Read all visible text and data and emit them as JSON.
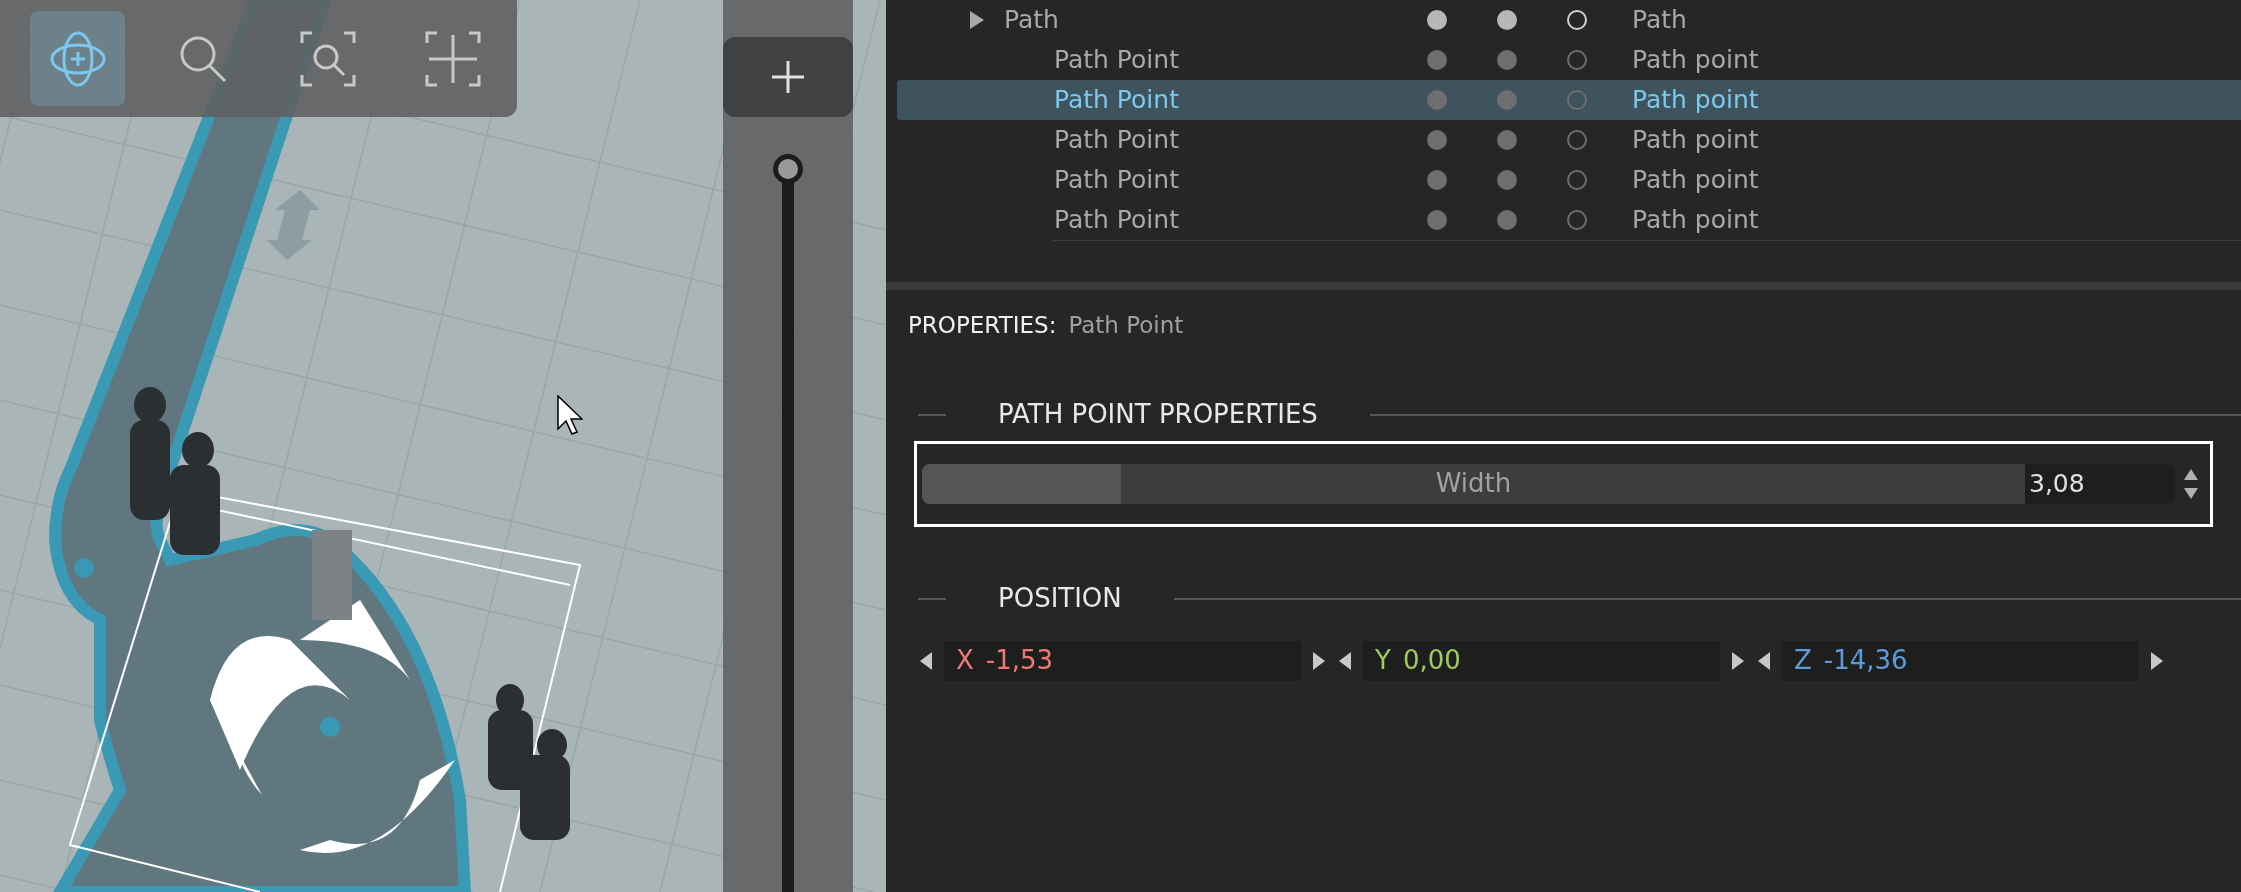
{
  "viewport": {
    "toolbar": [
      {
        "kind": "orbit",
        "selected": true
      },
      {
        "kind": "zoom",
        "selected": false
      },
      {
        "kind": "zoom_fit",
        "selected": false
      },
      {
        "kind": "frame",
        "selected": false
      }
    ],
    "zoom_slider": {
      "level": 1
    }
  },
  "tree": {
    "items": [
      {
        "name": "Path",
        "type": "Path",
        "selected": false,
        "children": [
          {
            "name": "Path Point",
            "type": "Path point",
            "selected": false
          },
          {
            "name": "Path Point",
            "type": "Path point",
            "selected": true
          },
          {
            "name": "Path Point",
            "type": "Path point",
            "selected": false
          },
          {
            "name": "Path Point",
            "type": "Path point",
            "selected": false
          },
          {
            "name": "Path Point",
            "type": "Path point",
            "selected": false
          }
        ]
      }
    ]
  },
  "properties": {
    "label": "PROPERTIES:",
    "subject": "Path Point",
    "sections": [
      {
        "title": "PATH POINT PROPERTIES",
        "highlighted": true,
        "fields": [
          {
            "kind": "slider",
            "label": "Width",
            "level": 0.18,
            "value": "3,08"
          }
        ]
      },
      {
        "title": "POSITION",
        "highlighted": false,
        "fields": [
          {
            "kind": "vector",
            "axes": [
              {
                "axis": "X",
                "value": "-1,53",
                "color": "#f07874"
              },
              {
                "axis": "Y",
                "value": "0,00",
                "color": "#9ccb5c"
              },
              {
                "axis": "Z",
                "value": "-14,36",
                "color": "#5b9bd8"
              }
            ]
          }
        ]
      }
    ]
  }
}
